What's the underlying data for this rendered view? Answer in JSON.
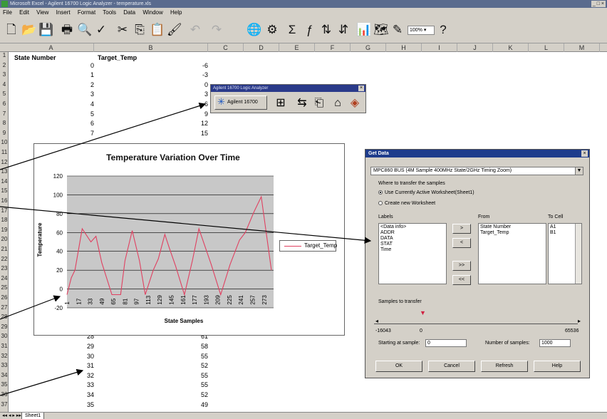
{
  "window": {
    "title": "Microsoft Excel - Agilent 16700 Logic Analyzer - temperature.xls",
    "controls": "_ □ ×"
  },
  "menu": [
    "File",
    "Edit",
    "View",
    "Insert",
    "Format",
    "Tools",
    "Data",
    "Window",
    "Help"
  ],
  "toolbar": {
    "zoom": "100% ▾"
  },
  "columns": [
    "A",
    "B",
    "C",
    "D",
    "E",
    "F",
    "G",
    "H",
    "I",
    "J",
    "K",
    "L",
    "M"
  ],
  "rows": [
    "1",
    "2",
    "3",
    "4",
    "5",
    "6",
    "7",
    "8",
    "9",
    "10",
    "11",
    "12",
    "13",
    "14",
    "15",
    "16",
    "17",
    "18",
    "19",
    "20",
    "21",
    "22",
    "23",
    "24",
    "25",
    "26",
    "27",
    "28",
    "29",
    "30",
    "31",
    "32",
    "33",
    "34",
    "35",
    "36",
    "37"
  ],
  "sheet": {
    "header_a": "State Number",
    "header_b": "Target_Temp",
    "top_rows": [
      [
        "0",
        "-6"
      ],
      [
        "1",
        "-3"
      ],
      [
        "2",
        "0"
      ],
      [
        "3",
        "3"
      ],
      [
        "4",
        "6"
      ],
      [
        "5",
        "9"
      ],
      [
        "6",
        "12"
      ],
      [
        "7",
        "15"
      ]
    ],
    "bottom_rows": [
      [
        "28",
        "61"
      ],
      [
        "29",
        "58"
      ],
      [
        "30",
        "55"
      ],
      [
        "31",
        "52"
      ],
      [
        "32",
        "55"
      ],
      [
        "33",
        "55"
      ],
      [
        "34",
        "52"
      ],
      [
        "35",
        "49"
      ]
    ],
    "tab": "Sheet1"
  },
  "agilent_toolbar": {
    "title": "Agilent 16700 Logic Analyzer",
    "button": "Agilent 16700"
  },
  "chart_data": {
    "type": "line",
    "title": "Temperature Variation Over Time",
    "xlabel": "State Samples",
    "ylabel": "Temperature",
    "ylim": [
      -20,
      120
    ],
    "yticks": [
      -20,
      0,
      20,
      40,
      60,
      80,
      100,
      120
    ],
    "xticks": [
      "1",
      "17",
      "33",
      "49",
      "65",
      "81",
      "97",
      "113",
      "129",
      "145",
      "161",
      "177",
      "193",
      "209",
      "225",
      "241",
      "257",
      "273"
    ],
    "grid": true,
    "legend_position": "right",
    "series": [
      {
        "name": "Target_Temp",
        "x": [
          0,
          6,
          11,
          21,
          33,
          40,
          48,
          62,
          74,
          80,
          90,
          100,
          108,
          119,
          126,
          135,
          141,
          150,
          162,
          173,
          182,
          199,
          212,
          225,
          238,
          246,
          258,
          268,
          282
        ],
        "values": [
          -6,
          12,
          20,
          64,
          50,
          56,
          28,
          -6,
          -6,
          30,
          62,
          30,
          -6,
          20,
          32,
          58,
          44,
          24,
          -6,
          30,
          64,
          26,
          -6,
          26,
          52,
          60,
          82,
          98,
          20
        ]
      }
    ],
    "color": "#e04060"
  },
  "dialog": {
    "title": "Get Data",
    "module": "MPC860 BUS  (4M Sample 400MHz State/2GHz Timing Zoom)",
    "where": "Where to transfer the samples",
    "opt1": "Use Currently Active Worksheet(Sheet1)",
    "opt2": "Create new Worksheet",
    "labels_h": "Labels",
    "from_h": "From",
    "tocell_h": "To Cell",
    "labels": [
      "<Data info>",
      "ADDR",
      "DATA",
      "STAT",
      "Time"
    ],
    "from": [
      "State Number",
      "Target_Temp"
    ],
    "tocell": [
      "A1",
      "B1"
    ],
    "btn_add": ">",
    "btn_remove": "<",
    "btn_addall": ">>",
    "btn_removeall": "<<",
    "samples_h": "Samples to transfer",
    "min": "-16043",
    "zero": "0",
    "max": "65536",
    "start_label": "Starting at sample:",
    "start_val": "0",
    "num_label": "Number of samples:",
    "num_val": "1000",
    "ok": "OK",
    "cancel": "Cancel",
    "refresh": "Refresh",
    "help": "Help"
  }
}
